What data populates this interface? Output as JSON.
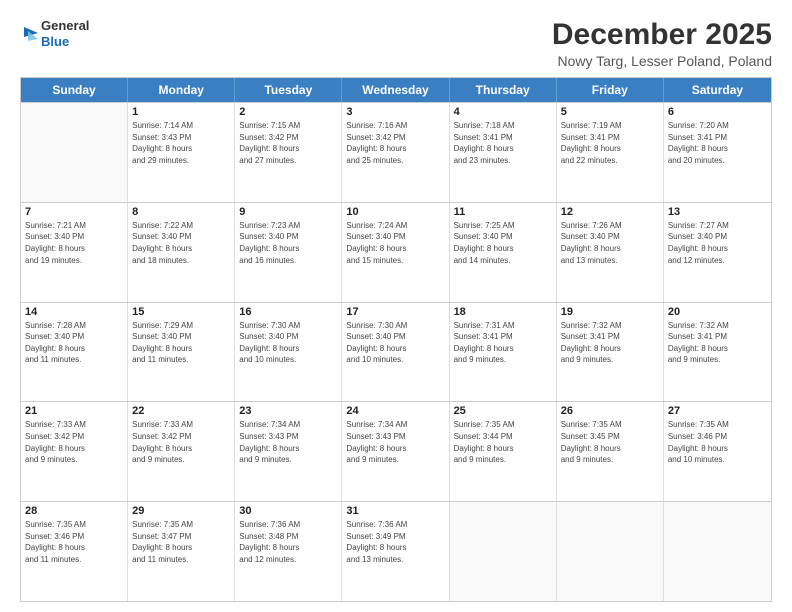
{
  "logo": {
    "line1": "General",
    "line2": "Blue"
  },
  "title": "December 2025",
  "subtitle": "Nowy Targ, Lesser Poland, Poland",
  "days_of_week": [
    "Sunday",
    "Monday",
    "Tuesday",
    "Wednesday",
    "Thursday",
    "Friday",
    "Saturday"
  ],
  "weeks": [
    [
      {
        "day": "",
        "info": ""
      },
      {
        "day": "1",
        "info": "Sunrise: 7:14 AM\nSunset: 3:43 PM\nDaylight: 8 hours\nand 29 minutes."
      },
      {
        "day": "2",
        "info": "Sunrise: 7:15 AM\nSunset: 3:42 PM\nDaylight: 8 hours\nand 27 minutes."
      },
      {
        "day": "3",
        "info": "Sunrise: 7:16 AM\nSunset: 3:42 PM\nDaylight: 8 hours\nand 25 minutes."
      },
      {
        "day": "4",
        "info": "Sunrise: 7:18 AM\nSunset: 3:41 PM\nDaylight: 8 hours\nand 23 minutes."
      },
      {
        "day": "5",
        "info": "Sunrise: 7:19 AM\nSunset: 3:41 PM\nDaylight: 8 hours\nand 22 minutes."
      },
      {
        "day": "6",
        "info": "Sunrise: 7:20 AM\nSunset: 3:41 PM\nDaylight: 8 hours\nand 20 minutes."
      }
    ],
    [
      {
        "day": "7",
        "info": "Sunrise: 7:21 AM\nSunset: 3:40 PM\nDaylight: 8 hours\nand 19 minutes."
      },
      {
        "day": "8",
        "info": "Sunrise: 7:22 AM\nSunset: 3:40 PM\nDaylight: 8 hours\nand 18 minutes."
      },
      {
        "day": "9",
        "info": "Sunrise: 7:23 AM\nSunset: 3:40 PM\nDaylight: 8 hours\nand 16 minutes."
      },
      {
        "day": "10",
        "info": "Sunrise: 7:24 AM\nSunset: 3:40 PM\nDaylight: 8 hours\nand 15 minutes."
      },
      {
        "day": "11",
        "info": "Sunrise: 7:25 AM\nSunset: 3:40 PM\nDaylight: 8 hours\nand 14 minutes."
      },
      {
        "day": "12",
        "info": "Sunrise: 7:26 AM\nSunset: 3:40 PM\nDaylight: 8 hours\nand 13 minutes."
      },
      {
        "day": "13",
        "info": "Sunrise: 7:27 AM\nSunset: 3:40 PM\nDaylight: 8 hours\nand 12 minutes."
      }
    ],
    [
      {
        "day": "14",
        "info": "Sunrise: 7:28 AM\nSunset: 3:40 PM\nDaylight: 8 hours\nand 11 minutes."
      },
      {
        "day": "15",
        "info": "Sunrise: 7:29 AM\nSunset: 3:40 PM\nDaylight: 8 hours\nand 11 minutes."
      },
      {
        "day": "16",
        "info": "Sunrise: 7:30 AM\nSunset: 3:40 PM\nDaylight: 8 hours\nand 10 minutes."
      },
      {
        "day": "17",
        "info": "Sunrise: 7:30 AM\nSunset: 3:40 PM\nDaylight: 8 hours\nand 10 minutes."
      },
      {
        "day": "18",
        "info": "Sunrise: 7:31 AM\nSunset: 3:41 PM\nDaylight: 8 hours\nand 9 minutes."
      },
      {
        "day": "19",
        "info": "Sunrise: 7:32 AM\nSunset: 3:41 PM\nDaylight: 8 hours\nand 9 minutes."
      },
      {
        "day": "20",
        "info": "Sunrise: 7:32 AM\nSunset: 3:41 PM\nDaylight: 8 hours\nand 9 minutes."
      }
    ],
    [
      {
        "day": "21",
        "info": "Sunrise: 7:33 AM\nSunset: 3:42 PM\nDaylight: 8 hours\nand 9 minutes."
      },
      {
        "day": "22",
        "info": "Sunrise: 7:33 AM\nSunset: 3:42 PM\nDaylight: 8 hours\nand 9 minutes."
      },
      {
        "day": "23",
        "info": "Sunrise: 7:34 AM\nSunset: 3:43 PM\nDaylight: 8 hours\nand 9 minutes."
      },
      {
        "day": "24",
        "info": "Sunrise: 7:34 AM\nSunset: 3:43 PM\nDaylight: 8 hours\nand 9 minutes."
      },
      {
        "day": "25",
        "info": "Sunrise: 7:35 AM\nSunset: 3:44 PM\nDaylight: 8 hours\nand 9 minutes."
      },
      {
        "day": "26",
        "info": "Sunrise: 7:35 AM\nSunset: 3:45 PM\nDaylight: 8 hours\nand 9 minutes."
      },
      {
        "day": "27",
        "info": "Sunrise: 7:35 AM\nSunset: 3:46 PM\nDaylight: 8 hours\nand 10 minutes."
      }
    ],
    [
      {
        "day": "28",
        "info": "Sunrise: 7:35 AM\nSunset: 3:46 PM\nDaylight: 8 hours\nand 11 minutes."
      },
      {
        "day": "29",
        "info": "Sunrise: 7:35 AM\nSunset: 3:47 PM\nDaylight: 8 hours\nand 11 minutes."
      },
      {
        "day": "30",
        "info": "Sunrise: 7:36 AM\nSunset: 3:48 PM\nDaylight: 8 hours\nand 12 minutes."
      },
      {
        "day": "31",
        "info": "Sunrise: 7:36 AM\nSunset: 3:49 PM\nDaylight: 8 hours\nand 13 minutes."
      },
      {
        "day": "",
        "info": ""
      },
      {
        "day": "",
        "info": ""
      },
      {
        "day": "",
        "info": ""
      }
    ]
  ]
}
